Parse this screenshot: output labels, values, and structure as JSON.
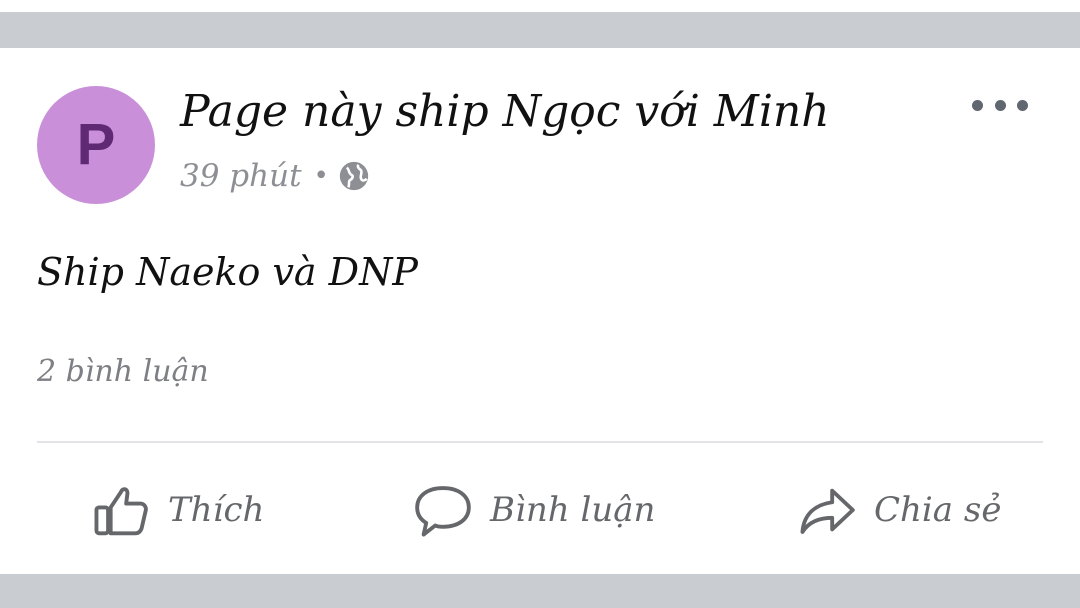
{
  "post": {
    "avatar_letter": "P",
    "page_name": "Page này ship Ngọc với Minh",
    "time": "39 phút",
    "separator": "•",
    "privacy_icon": "globe-icon",
    "more_icon": "more-horizontal-icon",
    "text": "Ship Naeko và DNP",
    "comments_count": "2 bình luận"
  },
  "actions": {
    "like": {
      "label": "Thích",
      "icon": "thumbs-up-icon"
    },
    "comment": {
      "label": "Bình luận",
      "icon": "comment-icon"
    },
    "share": {
      "label": "Chia sẻ",
      "icon": "share-icon"
    }
  },
  "colors": {
    "avatar_bg": "#c990d9",
    "avatar_letter": "#5f2a73",
    "frame_gray": "#c9ccd1",
    "muted_text": "#65676b"
  }
}
